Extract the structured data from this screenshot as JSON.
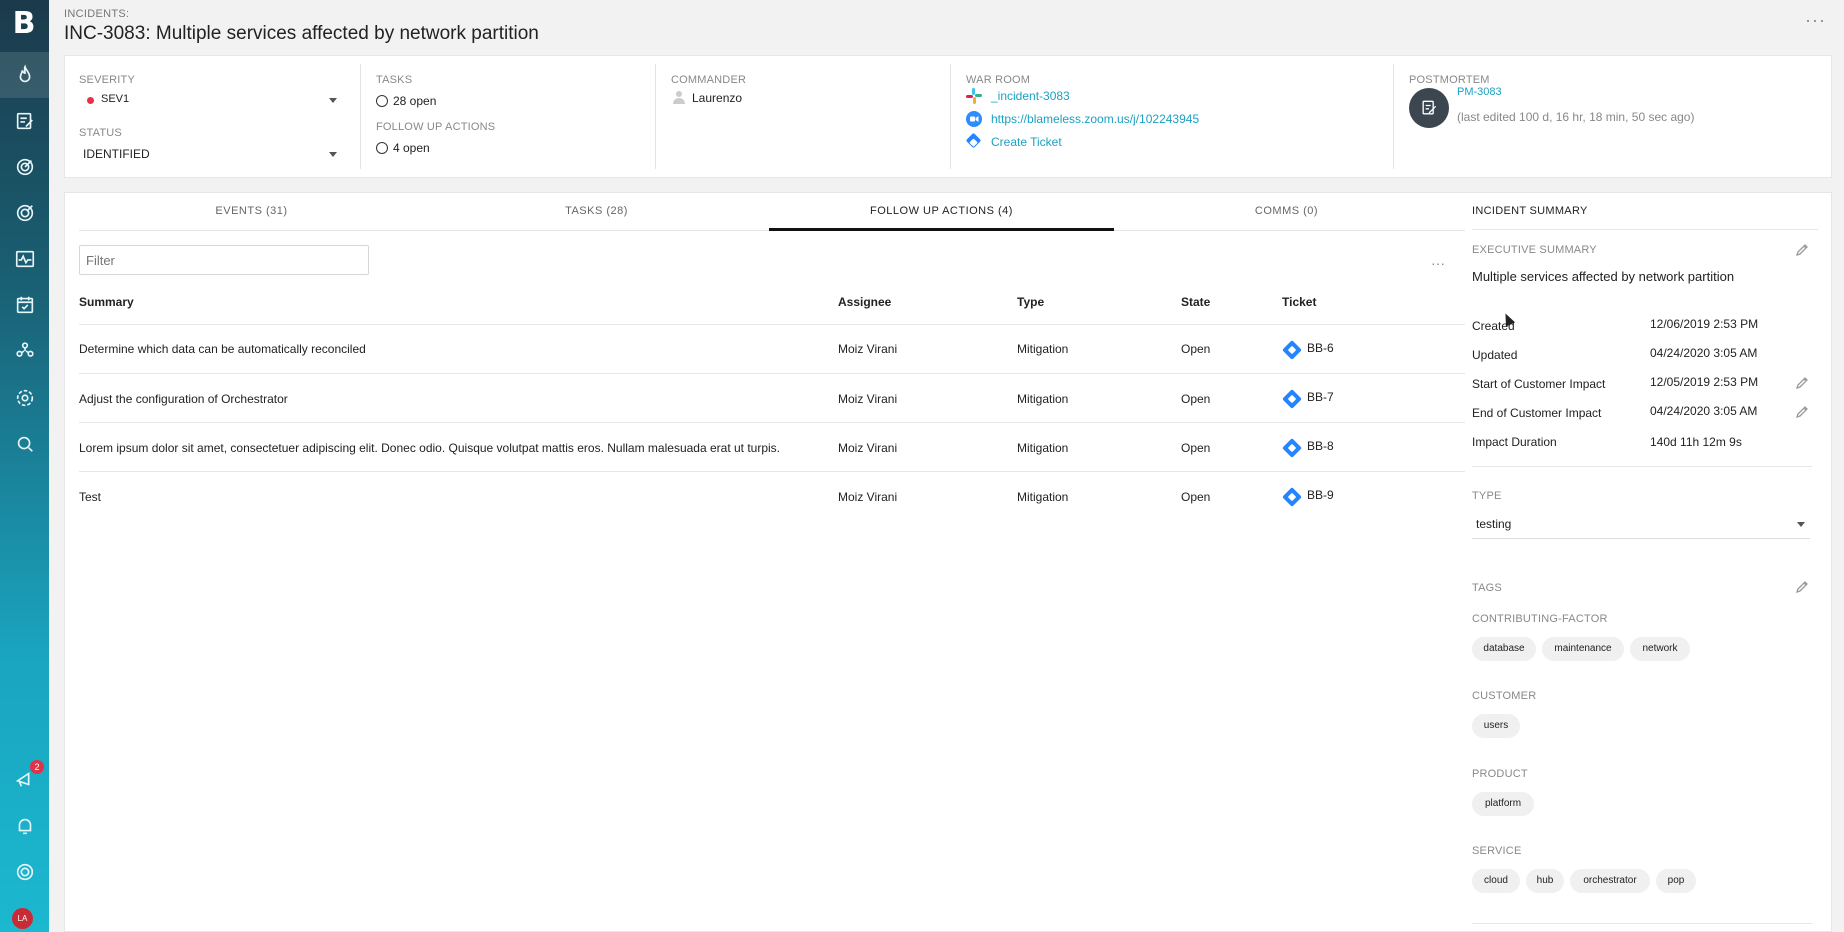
{
  "sidebar": {
    "logo": "B",
    "items": [
      {
        "icon": "flame-icon"
      },
      {
        "icon": "edit-list-icon"
      },
      {
        "icon": "target-icon"
      },
      {
        "icon": "target-check-icon"
      },
      {
        "icon": "pulse-icon"
      },
      {
        "icon": "calendar-check-icon"
      },
      {
        "icon": "team-icon"
      },
      {
        "icon": "gear-icon"
      },
      {
        "icon": "search-icon"
      }
    ],
    "bottom": [
      {
        "icon": "megaphone-icon",
        "badge": "2"
      },
      {
        "icon": "bell-icon"
      },
      {
        "icon": "lifebuoy-icon"
      }
    ],
    "avatar_initials": "LA"
  },
  "header": {
    "breadcrumb": "INCIDENTS:",
    "title": "INC-3083: Multiple services affected by network partition",
    "more": "···"
  },
  "info": {
    "severity_label": "SEVERITY",
    "severity_value": "SEV1",
    "status_label": "STATUS",
    "status_value": "IDENTIFIED",
    "tasks_label": "TASKS",
    "tasks_value": "28 open",
    "followup_label": "FOLLOW UP ACTIONS",
    "followup_value": "4 open",
    "commander_label": "COMMANDER",
    "commander_value": "Laurenzo",
    "warroom_label": "WAR ROOM",
    "slack_channel": "_incident-3083",
    "zoom_link": "https://blameless.zoom.us/j/102243945",
    "create_ticket": "Create Ticket",
    "postmortem_label": "POSTMORTEM",
    "postmortem_id": "PM-3083",
    "postmortem_edited": "(last edited 100 d, 16 hr, 18 min, 50 sec ago)"
  },
  "tabs": [
    {
      "label": "EVENTS (31)"
    },
    {
      "label": "TASKS (28)"
    },
    {
      "label": "FOLLOW UP ACTIONS (4)"
    },
    {
      "label": "COMMS (0)"
    }
  ],
  "table": {
    "filter_placeholder": "Filter",
    "more": "···",
    "headers": {
      "summary": "Summary",
      "assignee": "Assignee",
      "type": "Type",
      "state": "State",
      "ticket": "Ticket"
    },
    "rows": [
      {
        "summary": "Determine which data can be automatically reconciled",
        "assignee": "Moiz Virani",
        "type": "Mitigation",
        "state": "Open",
        "ticket": "BB-6"
      },
      {
        "summary": "Adjust the configuration of Orchestrator",
        "assignee": "Moiz Virani",
        "type": "Mitigation",
        "state": "Open",
        "ticket": "BB-7"
      },
      {
        "summary": "Lorem ipsum dolor sit amet, consectetuer adipiscing elit. Donec odio. Quisque volutpat mattis eros. Nullam malesuada erat ut turpis.",
        "assignee": "Moiz Virani",
        "type": "Mitigation",
        "state": "Open",
        "ticket": "BB-8"
      },
      {
        "summary": "Test",
        "assignee": "Moiz Virani",
        "type": "Mitigation",
        "state": "Open",
        "ticket": "BB-9"
      }
    ]
  },
  "summary": {
    "title": "INCIDENT SUMMARY",
    "exec_label": "EXECUTIVE SUMMARY",
    "exec_value": "Multiple services affected by network partition",
    "fields": [
      {
        "key": "Created",
        "value": "12/06/2019 2:53 PM"
      },
      {
        "key": "Updated",
        "value": "04/24/2020 3:05 AM"
      },
      {
        "key": "Start of Customer Impact",
        "value": "12/05/2019 2:53 PM"
      },
      {
        "key": "End of Customer Impact",
        "value": "04/24/2020 3:05 AM"
      },
      {
        "key": "Impact Duration",
        "value": "140d 11h 12m 9s"
      }
    ],
    "type_label": "TYPE",
    "type_value": "testing",
    "tags_label": "TAGS",
    "groups": [
      {
        "label": "CONTRIBUTING-FACTOR",
        "tags": [
          "database",
          "maintenance",
          "network"
        ]
      },
      {
        "label": "CUSTOMER",
        "tags": [
          "users"
        ]
      },
      {
        "label": "PRODUCT",
        "tags": [
          "platform"
        ]
      },
      {
        "label": "SERVICE",
        "tags": [
          "cloud",
          "hub",
          "orchestrator",
          "pop"
        ]
      }
    ]
  },
  "colors": {
    "accent": "#1ba1c2",
    "severity": "#e0334a",
    "jira": "#2684ff"
  }
}
